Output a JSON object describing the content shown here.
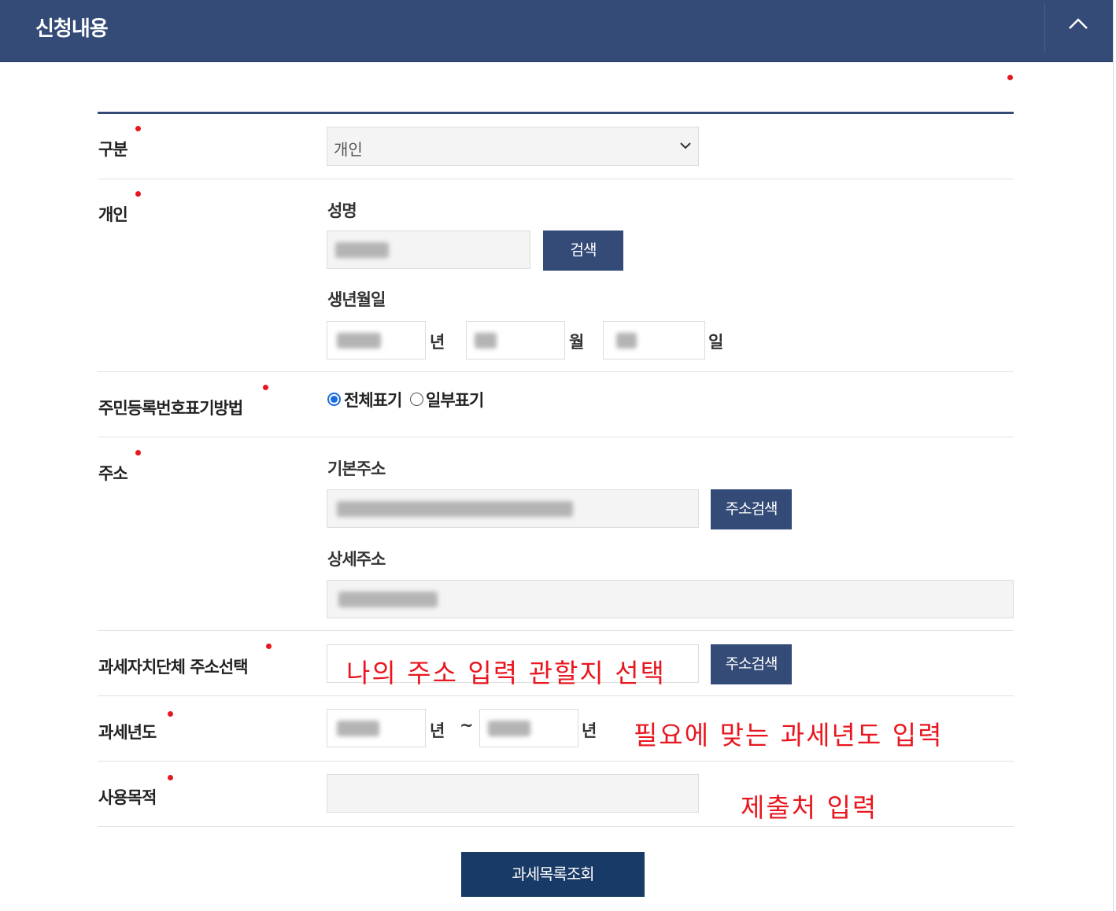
{
  "header": {
    "title": "신청내용",
    "collapse_icon": "chevron-up-icon"
  },
  "form": {
    "category": {
      "label": "구분",
      "selected": "개인",
      "icon": "chevron-down-icon"
    },
    "individual": {
      "label": "개인",
      "name_label": "성명",
      "name_value": "",
      "search_button": "검색",
      "birth_label": "생년월일",
      "year_unit": "년",
      "month_unit": "월",
      "day_unit": "일"
    },
    "rrn_display": {
      "label": "주민등록번호표기방법",
      "options": [
        {
          "label": "전체표기",
          "checked": true
        },
        {
          "label": "일부표기",
          "checked": false
        }
      ]
    },
    "address": {
      "label": "주소",
      "basic_label": "기본주소",
      "search_button": "주소검색",
      "detail_label": "상세주소"
    },
    "tax_authority": {
      "label": "과세자치단체 주소선택",
      "search_button": "주소검색"
    },
    "tax_year": {
      "label": "과세년도",
      "year_unit_start": "년",
      "separator": "~",
      "year_unit_end": "년"
    },
    "purpose": {
      "label": "사용목적",
      "value": ""
    },
    "submit_button": "과세목록조회"
  },
  "annotations": {
    "tax_authority_note": "나의 주소 입력 관할지 선택",
    "tax_year_note": "필요에 맞는 과세년도 입력",
    "purpose_note": "제출처 입력"
  },
  "colors": {
    "header_bg": "#344b78",
    "button_bg": "#344b78",
    "submit_bg": "#173a66",
    "required_dot": "#e8171f",
    "annotation_text": "#e8171f"
  }
}
